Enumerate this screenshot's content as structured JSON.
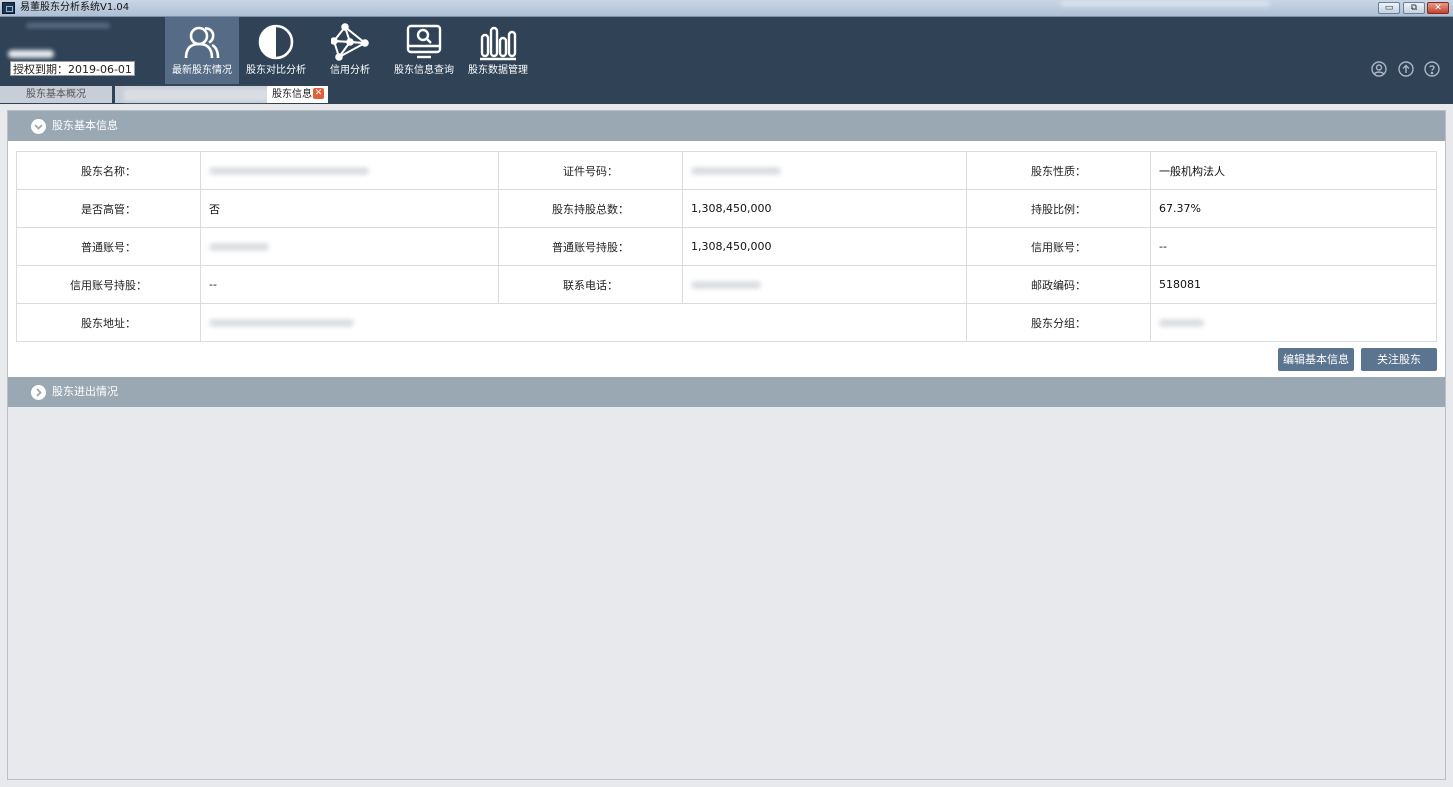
{
  "window": {
    "title": "易董股东分析系统V1.04",
    "controls": {
      "minimize": "▭",
      "restore": "⧉",
      "close": "✕"
    }
  },
  "header": {
    "license_text": "授权到期：2019-06-01",
    "nav": [
      {
        "label": "最新股东情况",
        "icon": "users-icon",
        "active": true
      },
      {
        "label": "股东对比分析",
        "icon": "contrast-icon",
        "active": false
      },
      {
        "label": "信用分析",
        "icon": "network-icon",
        "active": false
      },
      {
        "label": "股东信息查询",
        "icon": "search-monitor-icon",
        "active": false
      },
      {
        "label": "股东数据管理",
        "icon": "bar-chart-icon",
        "active": false
      }
    ],
    "right_icons": [
      "user-circle-icon",
      "upload-icon",
      "help-icon"
    ]
  },
  "tabs": [
    {
      "label": "股东基本概况",
      "active": false
    },
    {
      "label": "",
      "active": false,
      "redacted": true
    },
    {
      "label": "股东信息",
      "active": true,
      "closable": true
    }
  ],
  "sections": {
    "basic": {
      "title": "股东基本信息",
      "expanded": true
    },
    "movement": {
      "title": "股东进出情况",
      "expanded": false
    }
  },
  "info_rows": [
    {
      "l1": "股东名称：",
      "v1": "",
      "l2": "证件号码：",
      "v2": "",
      "l3": "股东性质：",
      "v3": "一般机构法人"
    },
    {
      "l1": "是否高管：",
      "v1": "否",
      "l2": "股东持股总数：",
      "v2": "1,308,450,000",
      "l3": "持股比例：",
      "v3": "67.37%"
    },
    {
      "l1": "普通账号：",
      "v1": "",
      "l2": "普通账号持股：",
      "v2": "1,308,450,000",
      "l3": "信用账号：",
      "v3": "--"
    },
    {
      "l1": "信用账号持股：",
      "v1": "--",
      "l2": "联系电话：",
      "v2": "",
      "l3": "邮政编码：",
      "v3": "518081"
    },
    {
      "l1": "股东地址：",
      "v1": "",
      "l3": "股东分组：",
      "v3": ""
    }
  ],
  "buttons": {
    "edit": "编辑基本信息",
    "follow": "关注股东"
  },
  "colors": {
    "header_bg": "#2f4256",
    "nav_active_bg": "#566c86",
    "section_bar": "#9aa8b4",
    "button_bg": "#5b7591"
  }
}
